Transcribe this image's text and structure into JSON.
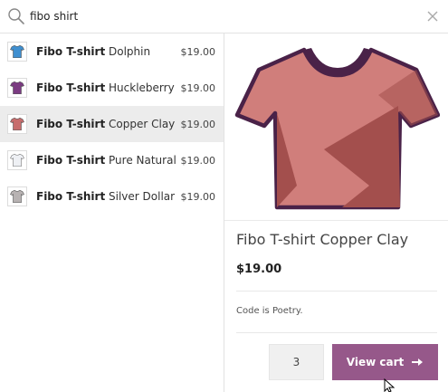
{
  "search": {
    "value": "fibo shirt",
    "placeholder": ""
  },
  "results": [
    {
      "brand": "Fibo T-shirt",
      "variant": "Dolphin",
      "price": "$19.00",
      "color": "#3f8fd0",
      "active": false
    },
    {
      "brand": "Fibo T-shirt",
      "variant": "Huckleberry",
      "price": "$19.00",
      "color": "#7b3b82",
      "active": false
    },
    {
      "brand": "Fibo T-shirt",
      "variant": "Copper Clay",
      "price": "$19.00",
      "color": "#c76d6d",
      "active": true
    },
    {
      "brand": "Fibo T-shirt",
      "variant": "Pure Natural",
      "price": "$19.00",
      "color": "#eef0f4",
      "active": false
    },
    {
      "brand": "Fibo T-shirt",
      "variant": "Silver Dollar",
      "price": "$19.00",
      "color": "#b8b3b3",
      "active": false
    }
  ],
  "detail": {
    "title": "Fibo T-shirt Copper Clay",
    "price": "$19.00",
    "description": "Code is Poetry.",
    "quantity": "3",
    "view_cart_label": "View cart",
    "shirt_color": "#d07e7b",
    "shirt_shadow": "#a34f4d",
    "shirt_outline": "#4a2248"
  },
  "colors": {
    "accent": "#96588a"
  },
  "icons": {
    "search": "search-icon",
    "close": "close-icon",
    "arrow": "arrow-right-icon",
    "cursor": "mouse-cursor-icon"
  }
}
